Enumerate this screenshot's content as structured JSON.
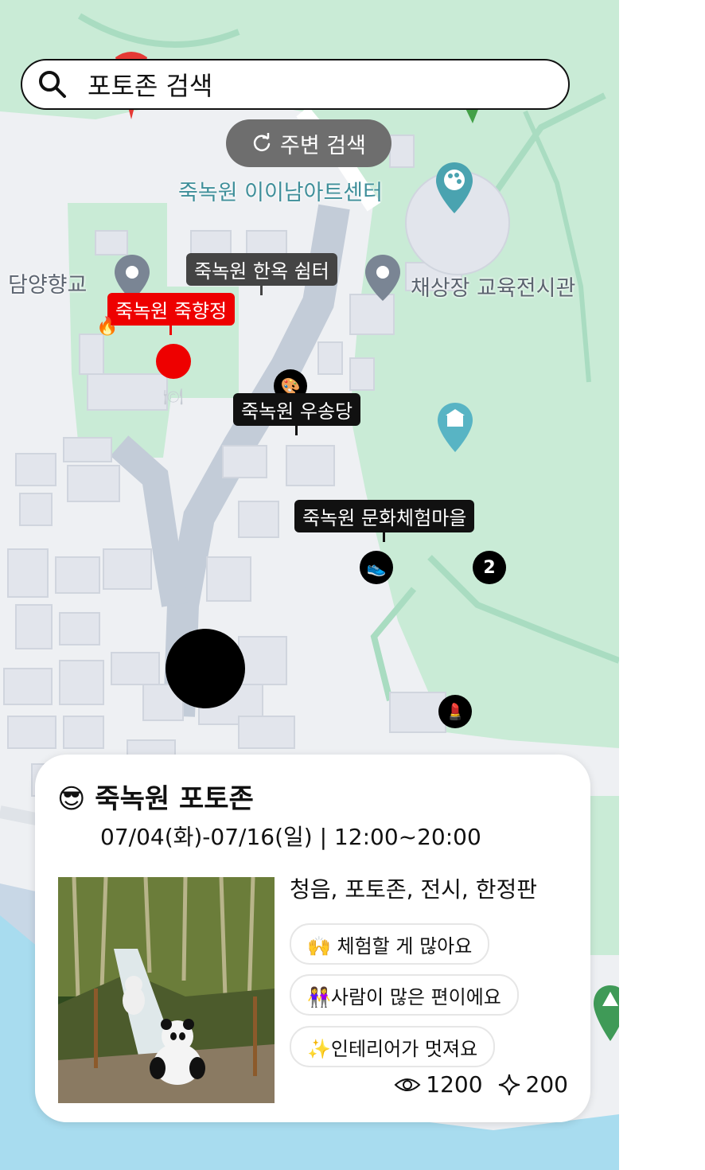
{
  "search": {
    "value": "포토존 검색"
  },
  "nearby_button": {
    "label": "주변 검색"
  },
  "map_labels": {
    "art_center": "죽녹원 이이남아트센터",
    "hyanggyo": "담양향교",
    "exhibition_hall": "채상장 교육전시관"
  },
  "markers": {
    "hanok_rest": "죽녹원 한옥 쉼터",
    "jukhyangjeong": "죽녹원 죽향정",
    "usongdang": "죽녹원 우송당",
    "culture_village": "죽녹원 문화체험마을",
    "cluster_count": "2",
    "user_emoji": "😎"
  },
  "card": {
    "emoji": "😎",
    "title": "죽녹원 포토존",
    "date": "07/04(화)-07/16(일) | 12:00~20:00",
    "tags": "청음, 포토존, 전시, 한정판",
    "chips": [
      "🙌 체험할 게 많아요",
      "👭사람이 많은 편이에요",
      "✨인테리어가 멋져요"
    ],
    "views": "1200",
    "likes": "200"
  },
  "colors": {
    "park_green": "#c9ebd6",
    "water_blue": "#a8dcef",
    "road_gray": "#c3ccd8",
    "accent_red": "#ee0000"
  }
}
